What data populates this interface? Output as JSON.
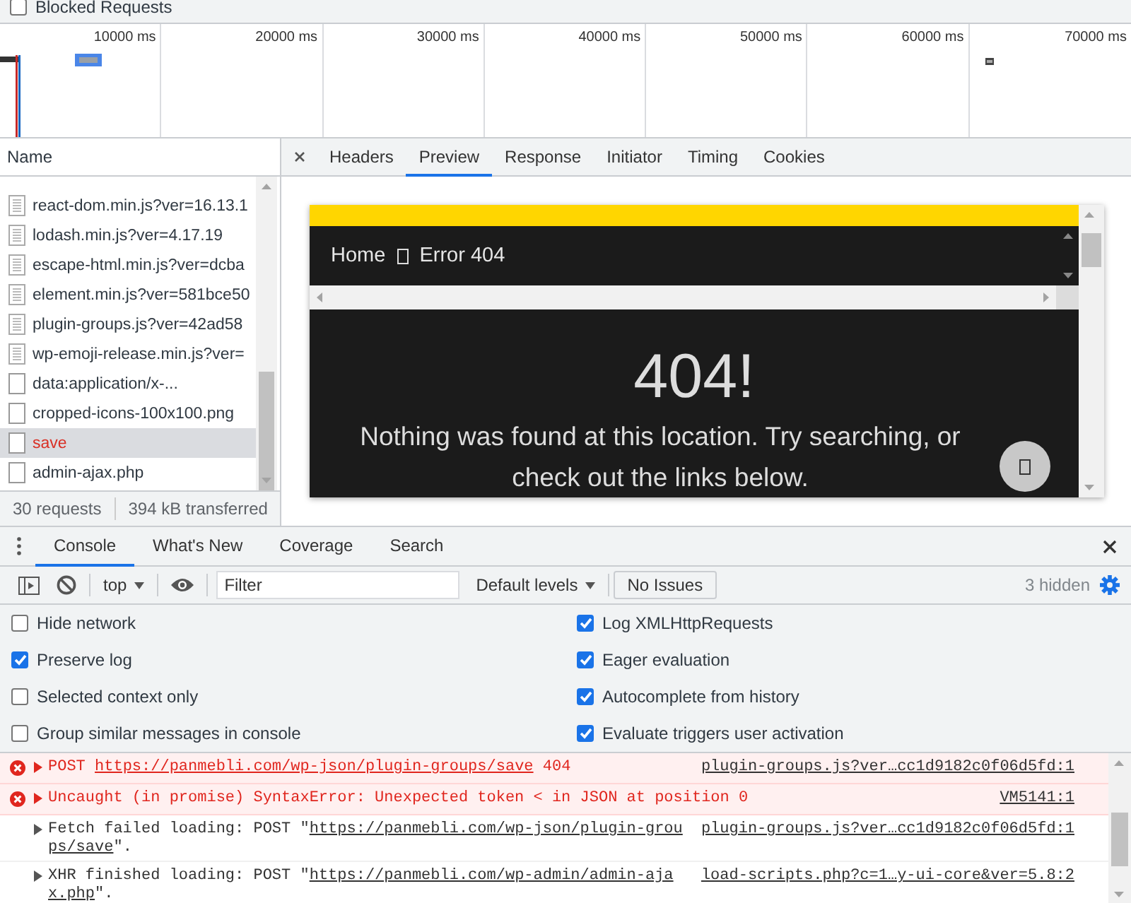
{
  "blocked_requests": {
    "label": "Blocked Requests",
    "checked": false
  },
  "timeline": {
    "ticks": [
      "10000 ms",
      "20000 ms",
      "30000 ms",
      "40000 ms",
      "50000 ms",
      "60000 ms",
      "70000 ms"
    ]
  },
  "requests": {
    "header": "Name",
    "items": [
      {
        "name": "react-dom.min.js?ver=16.13.1",
        "kind": "script",
        "selected": false,
        "failed": false
      },
      {
        "name": "lodash.min.js?ver=4.17.19",
        "kind": "script",
        "selected": false,
        "failed": false
      },
      {
        "name": "escape-html.min.js?ver=dcba",
        "kind": "script",
        "selected": false,
        "failed": false
      },
      {
        "name": "element.min.js?ver=581bce50",
        "kind": "script",
        "selected": false,
        "failed": false
      },
      {
        "name": "plugin-groups.js?ver=42ad58",
        "kind": "script",
        "selected": false,
        "failed": false
      },
      {
        "name": "wp-emoji-release.min.js?ver=",
        "kind": "script",
        "selected": false,
        "failed": false
      },
      {
        "name": "data:application/x-...",
        "kind": "other",
        "selected": false,
        "failed": false
      },
      {
        "name": "cropped-icons-100x100.png",
        "kind": "other",
        "selected": false,
        "failed": false
      },
      {
        "name": "save",
        "kind": "other",
        "selected": true,
        "failed": true
      },
      {
        "name": "admin-ajax.php",
        "kind": "other",
        "selected": false,
        "failed": false
      }
    ],
    "count": "30 requests",
    "transferred": "394 kB transferred"
  },
  "detail_tabs": [
    {
      "label": "Headers",
      "selected": false
    },
    {
      "label": "Preview",
      "selected": true
    },
    {
      "label": "Response",
      "selected": false
    },
    {
      "label": "Initiator",
      "selected": false
    },
    {
      "label": "Timing",
      "selected": false
    },
    {
      "label": "Cookies",
      "selected": false
    }
  ],
  "preview": {
    "breadcrumb": [
      "Home",
      "Error 404"
    ],
    "heading": "404!",
    "message": "Nothing was found at this location. Try searching, or check out the links below."
  },
  "drawer_tabs": [
    {
      "label": "Console",
      "selected": true
    },
    {
      "label": "What's New",
      "selected": false
    },
    {
      "label": "Coverage",
      "selected": false
    },
    {
      "label": "Search",
      "selected": false
    }
  ],
  "toolbar": {
    "context": "top",
    "filter_placeholder": "Filter",
    "levels": "Default levels",
    "issues": "No Issues",
    "hidden": "3 hidden"
  },
  "settings": [
    {
      "label": "Hide network",
      "checked": false
    },
    {
      "label": "Log XMLHttpRequests",
      "checked": true
    },
    {
      "label": "Preserve log",
      "checked": true
    },
    {
      "label": "Eager evaluation",
      "checked": true
    },
    {
      "label": "Selected context only",
      "checked": false
    },
    {
      "label": "Autocomplete from history",
      "checked": true
    },
    {
      "label": "Group similar messages in console",
      "checked": false
    },
    {
      "label": "Evaluate triggers user activation",
      "checked": true
    }
  ],
  "messages": [
    {
      "kind": "error",
      "text": "POST ",
      "url": "https://panmebli.com/wp-json/plugin-groups/save",
      "suffix": " 404",
      "source": "plugin-groups.js?ver…cc1d9182c0f06d5fd:1"
    },
    {
      "kind": "error",
      "text": "Uncaught (in promise) SyntaxError: Unexpected token < in JSON at position 0",
      "source": "VM5141:1"
    },
    {
      "kind": "info",
      "text": "Fetch failed loading: POST \"",
      "url": "https://panmebli.com/wp-json/plugin-groups/save",
      "suffix": "\".",
      "source": "plugin-groups.js?ver…cc1d9182c0f06d5fd:1"
    },
    {
      "kind": "info",
      "text": "XHR finished loading: POST \"",
      "url": "https://panmebli.com/wp-admin/admin-ajax.php",
      "suffix": "\".",
      "source": "load-scripts.php?c=1…y-ui-core&ver=5.8:2"
    }
  ]
}
